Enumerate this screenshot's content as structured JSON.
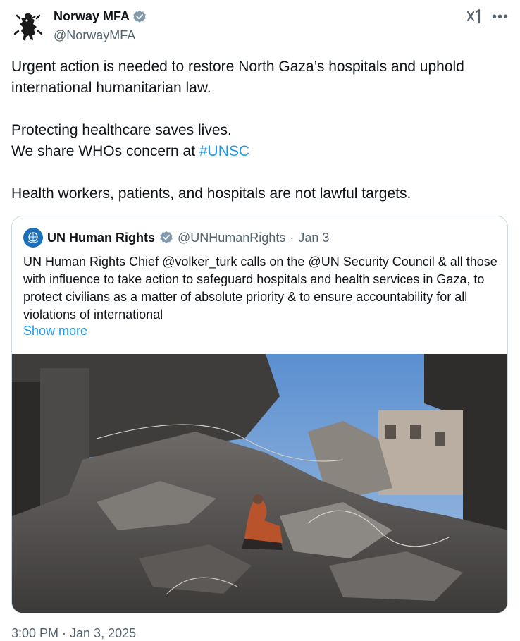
{
  "author": {
    "name": "Norway MFA",
    "handle": "@NorwayMFA"
  },
  "tweet": {
    "p1": "Urgent action is needed to restore North Gaza’s hospitals and uphold international humanitarian law.",
    "p2a": "Protecting healthcare saves lives.",
    "p2b_prefix": "We share WHOs concern at ",
    "hashtag": "#UNSC",
    "p3": "Health workers, patients, and hospitals are not lawful targets."
  },
  "quote": {
    "name": "UN Human Rights",
    "handle": "@UNHumanRights",
    "separator": "·",
    "date": "Jan 3",
    "text": "UN Human Rights Chief @volker_turk calls on the @UN Security Council & all those with influence to take action to safeguard hospitals and health services in Gaza, to protect civilians as a matter of absolute priority & to ensure accountability for all violations of international",
    "show_more": "Show more"
  },
  "timestamp": "3:00 PM · Jan 3, 2025",
  "colors": {
    "text": "#0f1419",
    "secondary": "#536471",
    "link": "#1d9bf0",
    "verified_badge": "#829aab",
    "border": "#cfd9de"
  },
  "icons": {
    "verified": "verified-badge-icon",
    "grok": "grok-icon",
    "more": "more-icon",
    "quote_avatar": "un-logo-icon"
  }
}
